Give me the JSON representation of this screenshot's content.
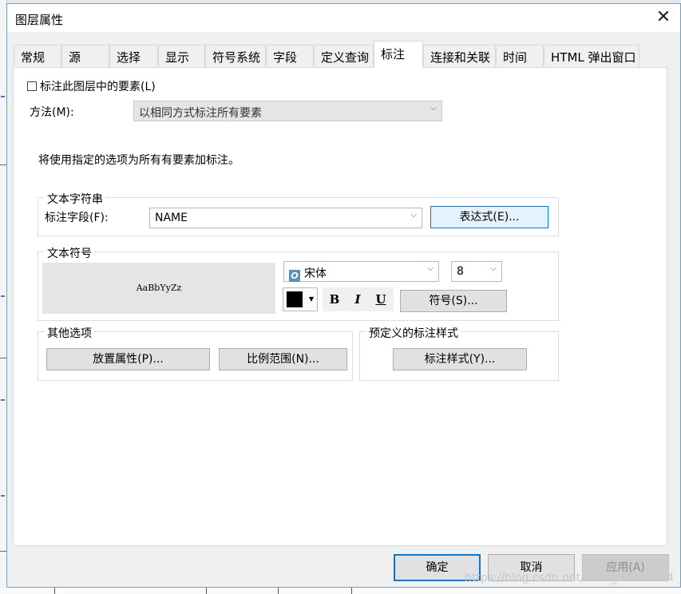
{
  "window": {
    "title": "图层属性",
    "close_glyph": "✕"
  },
  "tabs": [
    {
      "label": "常规"
    },
    {
      "label": "源"
    },
    {
      "label": "选择"
    },
    {
      "label": "显示"
    },
    {
      "label": "符号系统"
    },
    {
      "label": "字段"
    },
    {
      "label": "定义查询"
    },
    {
      "label": "标注",
      "active": true
    },
    {
      "label": "连接和关联"
    },
    {
      "label": "时间"
    },
    {
      "label": "HTML 弹出窗口"
    }
  ],
  "label_tab": {
    "checkbox_label": "标注此图层中的要素(L)",
    "checkbox_checked": false,
    "method_label": "方法(M):",
    "method_value": "以相同方式标注所有要素",
    "info_text": "将使用指定的选项为所有有要素加标注。",
    "text_string": {
      "group_title": "文本字符串",
      "field_label": "标注字段(F):",
      "field_value": "NAME",
      "expression_button": "表达式(E)..."
    },
    "text_symbol": {
      "group_title": "文本符号",
      "preview_text": "AaBbYyZz",
      "font_value": "宋体",
      "font_icon": "font-type-icon",
      "size_value": "8",
      "color": "#000000",
      "bold_label": "B",
      "italic_label": "I",
      "underline_label": "U",
      "symbol_button": "符号(S)..."
    },
    "other_options": {
      "group_title": "其他选项",
      "placement_button": "放置属性(P)...",
      "scale_button": "比例范围(N)..."
    },
    "predefined": {
      "group_title": "预定义的标注样式",
      "style_button": "标注样式(Y)..."
    }
  },
  "footer": {
    "ok_button": "确定",
    "cancel_button": "取消",
    "apply_button": "应用(A)"
  },
  "watermark": "https://blog.csdn.net/sinat_37215184",
  "colors": {
    "accent": "#0078d7",
    "dialog_bg": "#f0f0f0",
    "panel_bg": "#ffffff"
  }
}
